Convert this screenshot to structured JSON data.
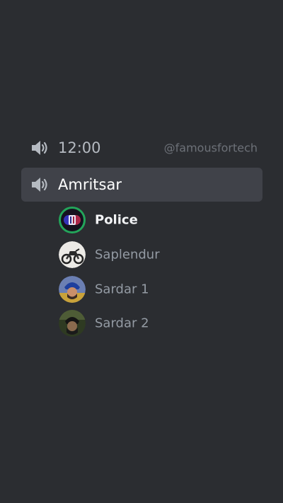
{
  "channels": [
    {
      "name": "12:00",
      "icon": "speaker-icon"
    },
    {
      "name": "Amritsar",
      "icon": "speaker-icon"
    }
  ],
  "watermark": "@famousfortech",
  "users": [
    {
      "name": "Police",
      "speaking": true,
      "avatar": "police-light-avatar"
    },
    {
      "name": "Saplendur",
      "speaking": false,
      "avatar": "motorcycle-avatar"
    },
    {
      "name": "Sardar 1",
      "speaking": false,
      "avatar": "turban-person-avatar"
    },
    {
      "name": "Sardar 2",
      "speaking": false,
      "avatar": "person-avatar"
    }
  ],
  "colors": {
    "background": "#2b2d31",
    "active_channel_bg": "#404249",
    "speaking_ring": "#23a55a",
    "muted_text": "#949ba4",
    "bright_text": "#ffffff"
  }
}
